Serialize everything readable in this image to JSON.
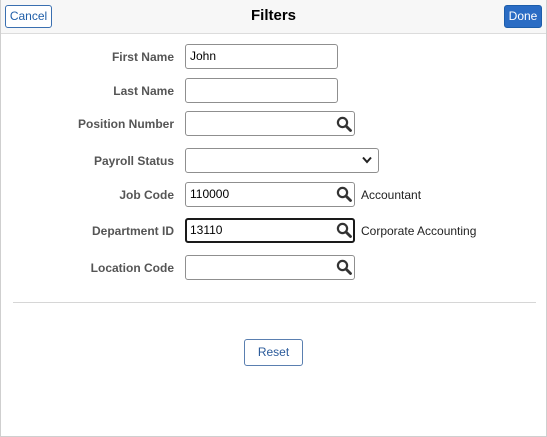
{
  "header": {
    "title": "Filters",
    "cancel_label": "Cancel",
    "done_label": "Done"
  },
  "fields": {
    "first_name": {
      "label": "First Name",
      "value": "John"
    },
    "last_name": {
      "label": "Last Name",
      "value": ""
    },
    "position_number": {
      "label": "Position Number",
      "value": "",
      "icon": "search-icon"
    },
    "payroll_status": {
      "label": "Payroll Status",
      "value": "",
      "icon": "chevron-down-icon"
    },
    "job_code": {
      "label": "Job Code",
      "value": "110000",
      "description": "Accountant",
      "icon": "search-icon"
    },
    "department_id": {
      "label": "Department ID",
      "value": "13110",
      "description": "Corporate Accounting",
      "icon": "search-icon",
      "focused": true
    },
    "location_code": {
      "label": "Location Code",
      "value": "",
      "icon": "search-icon"
    }
  },
  "footer": {
    "reset_label": "Reset"
  },
  "colors": {
    "accent": "#2a6cc4",
    "cancel_text": "#1f5ea8",
    "label_text": "#555555",
    "header_bg": "#f7f7f7"
  }
}
